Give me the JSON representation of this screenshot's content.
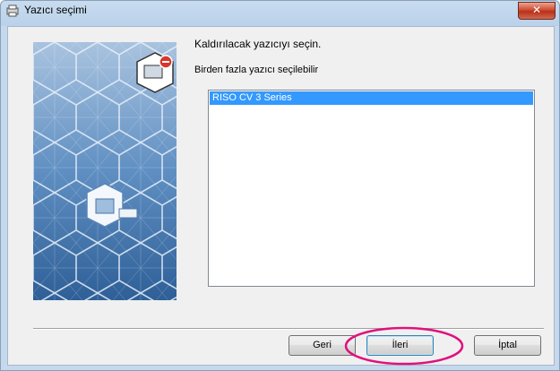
{
  "window": {
    "title": "Yazıcı seçimi",
    "close_label": "✕"
  },
  "content": {
    "instruction_primary": "Kaldırılacak yazıcıyı seçin.",
    "instruction_secondary": "Birden fazla yazıcı seçilebilir"
  },
  "printer_list": {
    "items": [
      {
        "label": "RISO CV 3 Series",
        "selected": true
      }
    ]
  },
  "buttons": {
    "back_label": "Geri",
    "next_label": "İleri",
    "cancel_label": "İptal"
  },
  "colors": {
    "selection": "#3399ff",
    "highlight_ellipse": "#e0117d",
    "banner_blue": "#3a6fa6"
  },
  "icons": {
    "title": "printer-window-icon",
    "banner_top": "printer-remove-icon",
    "banner_mid": "printer-cube-icon"
  }
}
